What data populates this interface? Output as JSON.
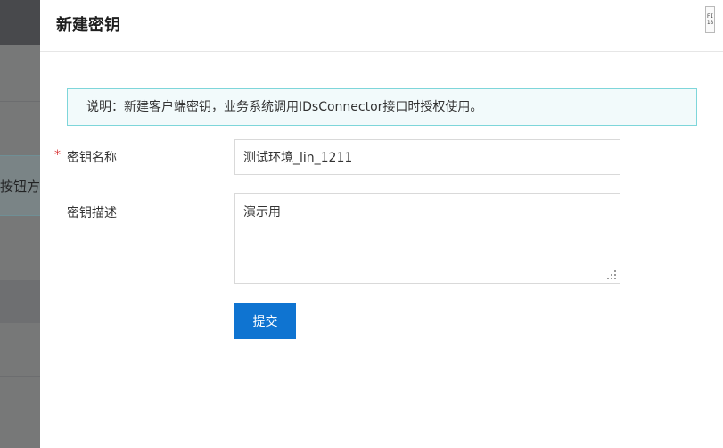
{
  "background": {
    "partial_text": "按钮方"
  },
  "drawer": {
    "title": "新建密钥",
    "fold_button_text": [
      "FI",
      "18"
    ]
  },
  "notice": {
    "text": "说明：新建客户端密钥，业务系统调用IDsConnector接口时授权使用。"
  },
  "form": {
    "required_mark": "*",
    "name": {
      "label": "密钥名称",
      "value": "测试环境_lin_1211"
    },
    "description": {
      "label": "密钥描述",
      "value": "演示用"
    },
    "submit_label": "提交"
  },
  "colors": {
    "primary": "#0f74d1",
    "notice_border": "#7ed6da",
    "notice_bg": "#f2fafb",
    "required": "#d9383a"
  }
}
